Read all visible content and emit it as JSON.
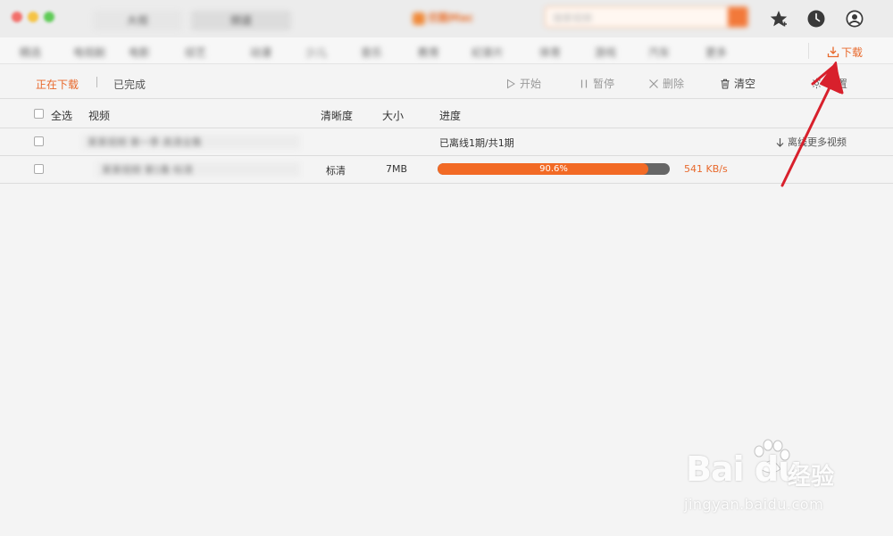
{
  "titlebar": {
    "tab_1": "大视",
    "tab_2": "频道",
    "logo": "优酷Mac",
    "search_placeholder": "搜索视频"
  },
  "nav": {
    "items": [
      "精选",
      "电视剧",
      "电影",
      "综艺",
      "动漫",
      "少儿",
      "音乐",
      "教育",
      "纪录片",
      "体育",
      "游戏",
      "汽车",
      "更多"
    ],
    "download_label": "下载"
  },
  "subtabs": {
    "downloading": "正在下载",
    "completed": "已完成"
  },
  "toolbar": {
    "start": "开始",
    "pause": "暂停",
    "delete": "删除",
    "clear": "清空",
    "settings": "设置"
  },
  "table": {
    "headers": {
      "select_all": "全选",
      "video": "视频",
      "definition": "清晰度",
      "size": "大小",
      "progress": "进度"
    },
    "group": {
      "title": "某某视频 第一季 高清全集",
      "status": "已离线1期/共1期",
      "more_link": "离线更多视频"
    },
    "item": {
      "title": "某某视频 第1集 标清",
      "definition": "标清",
      "size": "7MB",
      "progress_fraction": 0.906,
      "progress_label": "90.6%",
      "speed": "541 KB/s"
    }
  },
  "watermark": {
    "brand": "Bai du",
    "cn": "经验",
    "url": "jingyan.baidu.com"
  },
  "colors": {
    "accent": "#e8692c",
    "progress_fill": "#f26a25",
    "progress_track": "#666666",
    "annotation_arrow": "#d8202c"
  }
}
